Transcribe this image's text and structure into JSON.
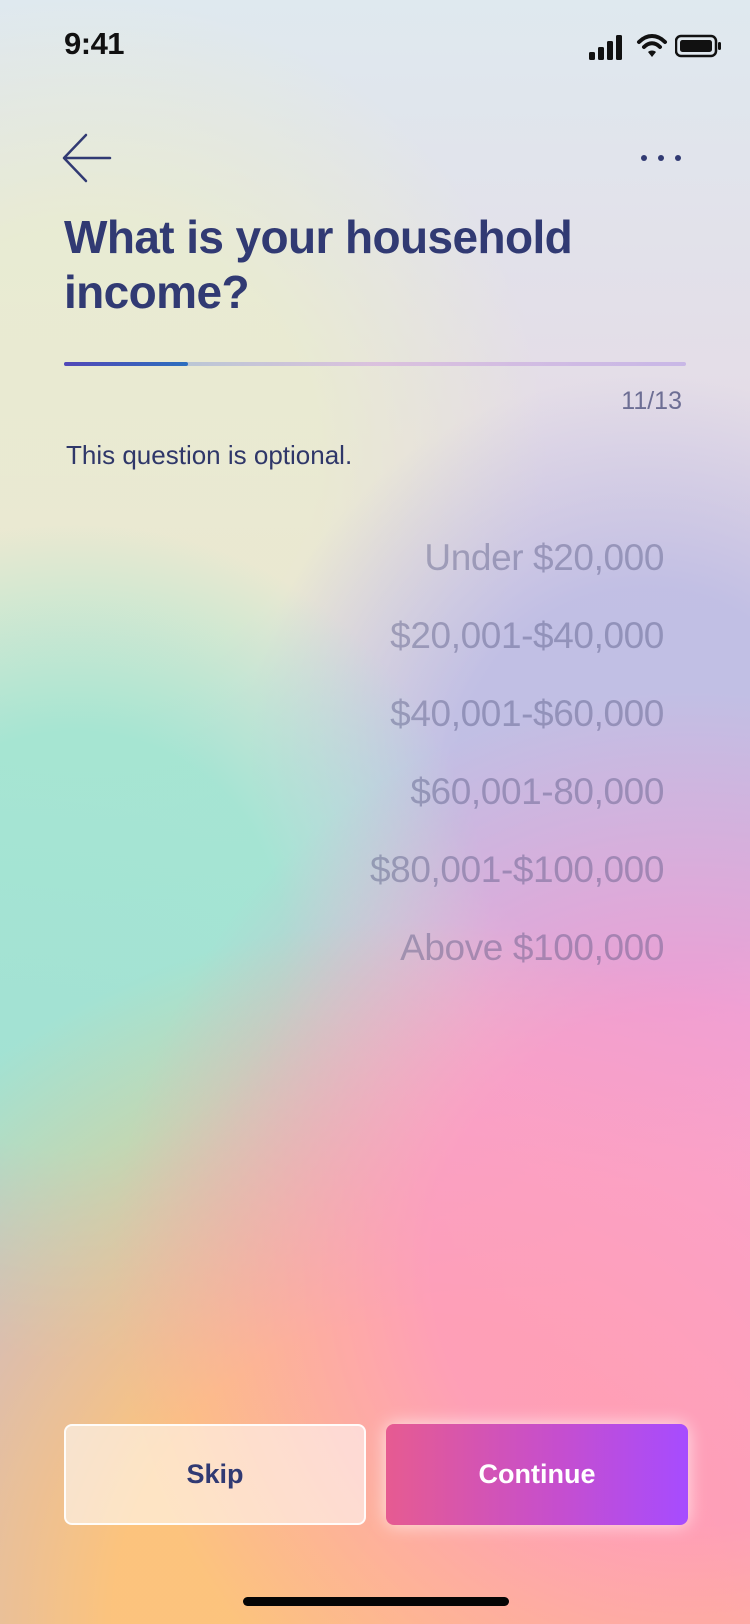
{
  "status_bar": {
    "time": "9:41"
  },
  "question": {
    "title_line_1": "What is your household",
    "title_line_2": "income?",
    "optional_note": "This question is optional.",
    "progress_label": "11/13",
    "progress_current": 11,
    "progress_total": 13,
    "progress_bar_fill_fraction": 0.2
  },
  "options": [
    "Under $20,000",
    "$20,001-$40,000",
    "$40,001-$60,000",
    "$60,001-80,000",
    "$80,001-$100,000",
    "Above $100,000"
  ],
  "actions": {
    "skip_label": "Skip",
    "continue_label": "Continue"
  },
  "icons": {
    "back": "arrow-left-icon",
    "more": "more-horizontal-icon",
    "signal": "signal-icon",
    "wifi": "wifi-icon",
    "battery": "battery-icon"
  },
  "colors": {
    "primary_text": "#313a73",
    "muted_text": "#6d6e94",
    "progress_start": "#5248b8",
    "progress_end": "#2c6fbe",
    "continue_start": "#e65b91",
    "continue_end": "#a64cff"
  }
}
